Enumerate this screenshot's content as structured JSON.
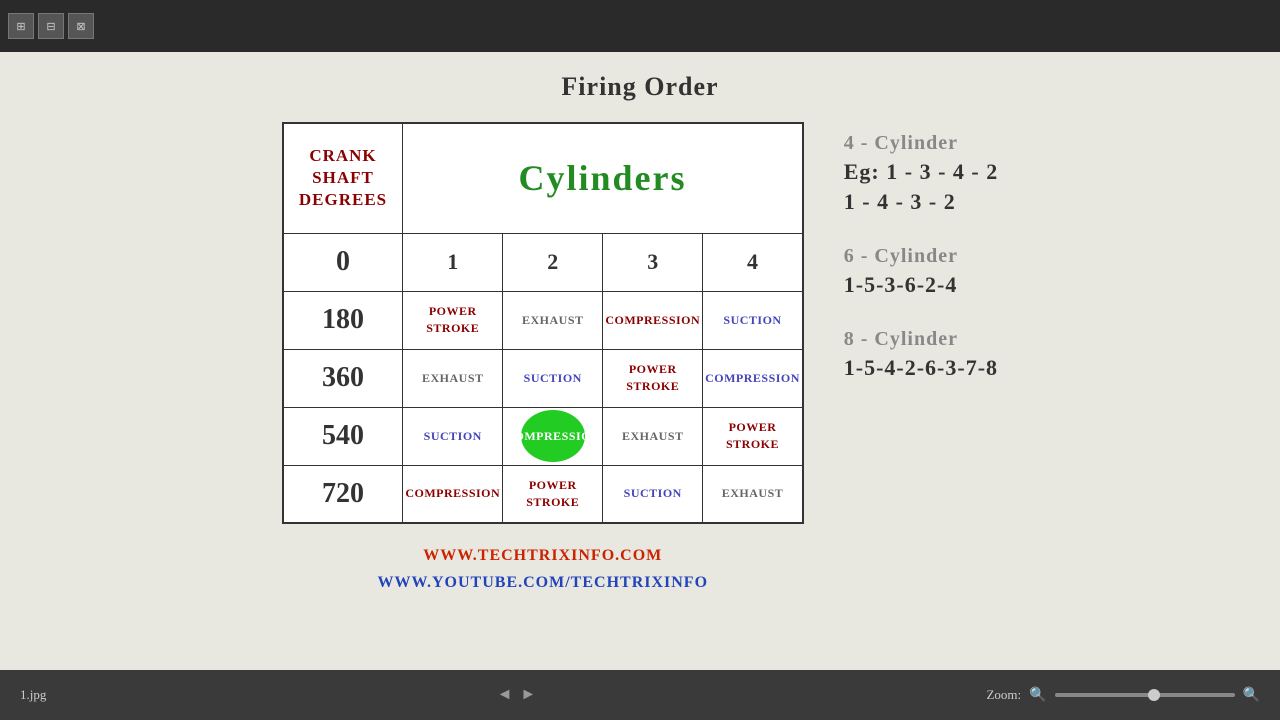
{
  "topbar": {
    "buttons": [
      "grid1",
      "grid2",
      "grid3"
    ]
  },
  "page": {
    "title": "Firing Order"
  },
  "table": {
    "crankshaft_label": "Crank Shaft Degrees",
    "cylinders_label": "Cylinders",
    "degrees": [
      "0",
      "180",
      "360",
      "540",
      "720"
    ],
    "cylinder_numbers": [
      "1",
      "2",
      "3",
      "4"
    ],
    "rows": [
      {
        "degree": "0",
        "cells": [
          "1",
          "2",
          "3",
          "4"
        ]
      },
      {
        "degree": "180",
        "cyl1": "Power Stroke",
        "cyl2": "Exhaust",
        "cyl3": "Compression",
        "cyl4": "Suction"
      },
      {
        "degree": "360",
        "cyl1": "Exhaust",
        "cyl2": "Suction",
        "cyl3": "Power Stroke",
        "cyl4": "Compression"
      },
      {
        "degree": "540",
        "cyl1": "Suction",
        "cyl2": "Compression",
        "cyl3": "Exhaust",
        "cyl4": "Power Stroke"
      },
      {
        "degree": "720",
        "cyl1": "Compression",
        "cyl2": "Power Stroke",
        "cyl3": "Suction",
        "cyl4": "Exhaust"
      }
    ]
  },
  "right_panel": {
    "cyl4_label": "4 - Cylinder",
    "cyl4_eg": "Eg: 1 - 3 - 4 - 2",
    "cyl4_eg2": "1 - 4 - 3 - 2",
    "cyl6_label": "6 - Cylinder",
    "cyl6_order": "1-5-3-6-2-4",
    "cyl8_label": "8 - Cylinder",
    "cyl8_order": "1-5-4-2-6-3-7-8"
  },
  "links": {
    "website": "www.techtrixinfo.com",
    "youtube": "www.youtube.com/techtrixinfo"
  },
  "statusbar": {
    "filename": "1.jpg",
    "zoom_label": "Zoom:",
    "zoom_value": "100%"
  },
  "icons": {
    "grid1": "⊞",
    "grid2": "⊟",
    "grid3": "⊠",
    "arrow_left": "◄",
    "arrow_right": "►",
    "zoom_in": "🔍",
    "zoom_out": "🔍"
  }
}
